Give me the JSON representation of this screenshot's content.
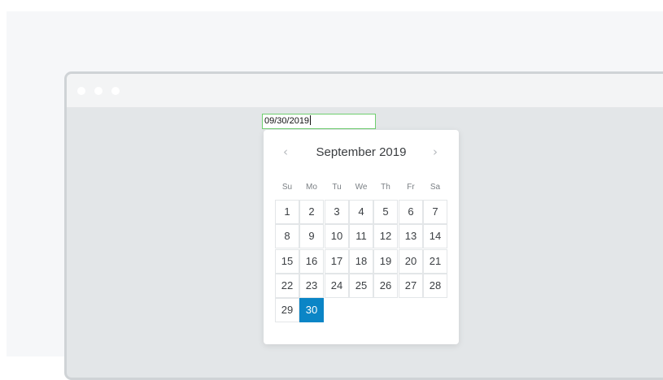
{
  "date_input": {
    "value": "09/30/2019"
  },
  "datepicker": {
    "month_title": "September 2019",
    "prev_icon": "chevron-left-icon",
    "next_icon": "chevron-right-icon",
    "prev_glyph": "‹",
    "next_glyph": "›",
    "weekdays": [
      "Su",
      "Mo",
      "Tu",
      "We",
      "Th",
      "Fr",
      "Sa"
    ],
    "first_weekday_index": 0,
    "days": [
      "1",
      "2",
      "3",
      "4",
      "5",
      "6",
      "7",
      "8",
      "9",
      "10",
      "11",
      "12",
      "13",
      "14",
      "15",
      "16",
      "17",
      "18",
      "19",
      "20",
      "21",
      "22",
      "23",
      "24",
      "25",
      "26",
      "27",
      "28",
      "29",
      "30"
    ],
    "selected_day": "30",
    "colors": {
      "selected_background": "#0b85c6",
      "input_border": "#6fcf6f"
    }
  }
}
